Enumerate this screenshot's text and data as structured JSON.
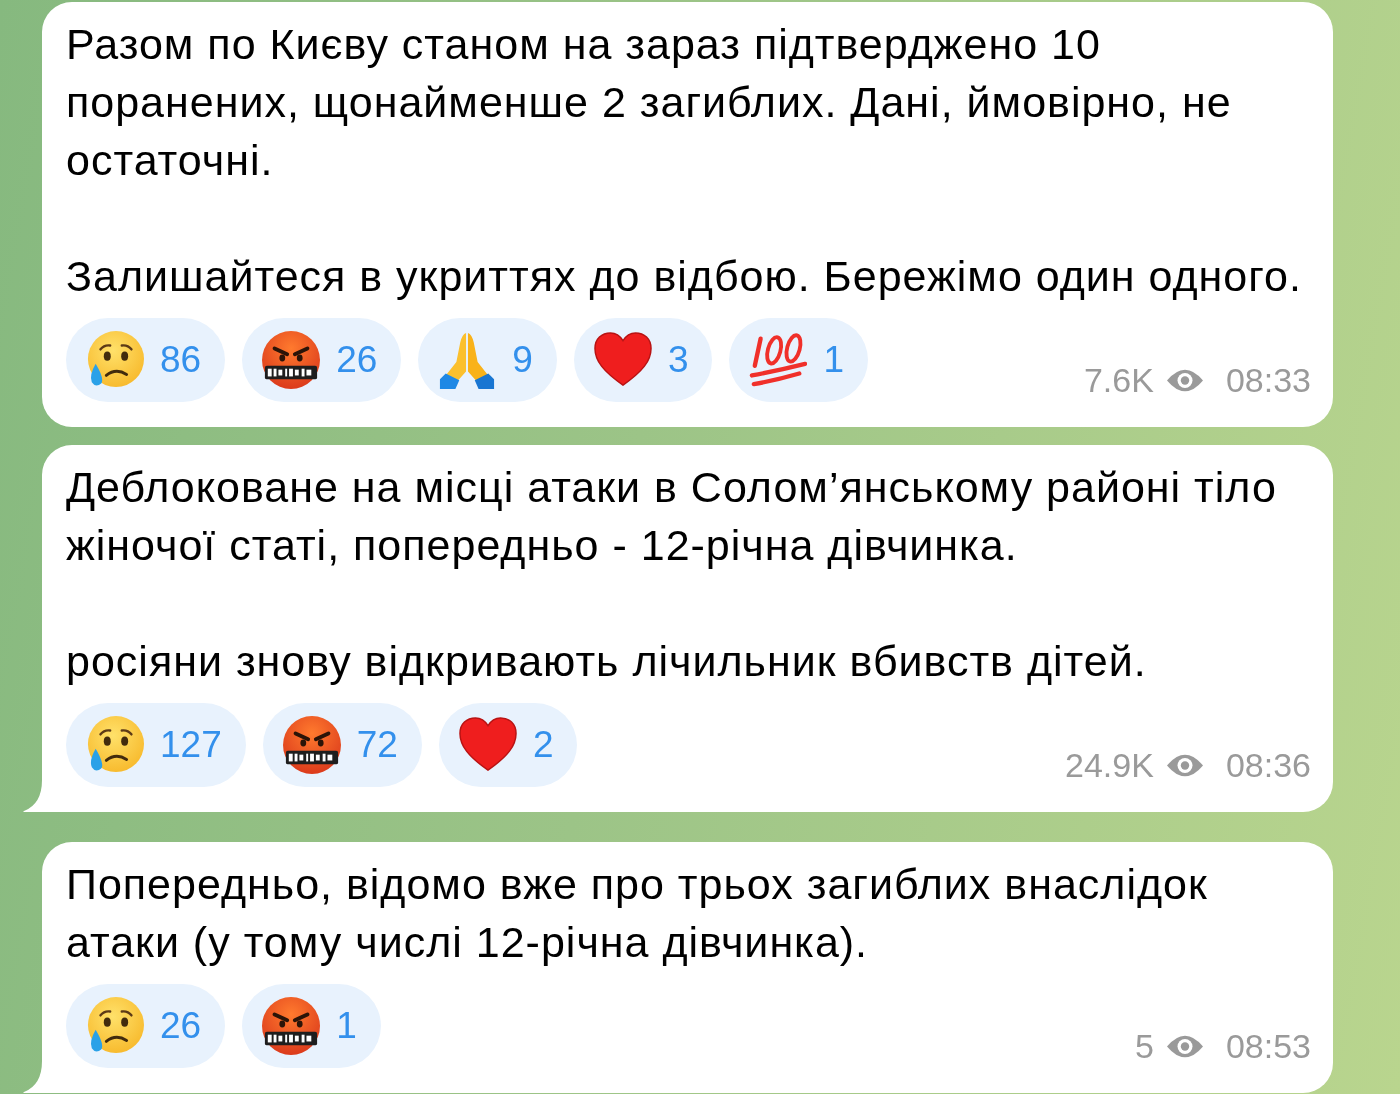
{
  "messages": [
    {
      "tail": false,
      "paragraphs": [
        "Разом по Києву станом на зараз підтверджено 10 поранених, щонайменше 2 загиблих. Дані, ймовірно, не остаточні.",
        "Залишайтеся в укриттях до відбою. Бережімо один одного."
      ],
      "reactions": [
        {
          "kind": "crying",
          "count": "86"
        },
        {
          "kind": "cursing",
          "count": "26"
        },
        {
          "kind": "praying",
          "count": "9"
        },
        {
          "kind": "heart",
          "count": "3"
        },
        {
          "kind": "hundred",
          "count": "1"
        }
      ],
      "views": "7.6K",
      "time": "08:33"
    },
    {
      "tail": true,
      "paragraphs": [
        "Деблоковане на місці атаки в Солом’янському районі тіло жіночої статі, попередньо - 12-річна дівчинка.",
        "росіяни знову відкривають лічильник вбивств дітей."
      ],
      "reactions": [
        {
          "kind": "crying",
          "count": "127"
        },
        {
          "kind": "cursing",
          "count": "72"
        },
        {
          "kind": "heart",
          "count": "2"
        }
      ],
      "views": "24.9K",
      "time": "08:36"
    },
    {
      "tail": true,
      "paragraphs": [
        "Попередньо, відомо вже про трьох загиблих внаслідок атаки (у тому числі 12-річна дівчинка)."
      ],
      "reactions": [
        {
          "kind": "crying",
          "count": "26"
        },
        {
          "kind": "cursing",
          "count": "1"
        }
      ],
      "views": "5",
      "time": "08:53"
    }
  ]
}
